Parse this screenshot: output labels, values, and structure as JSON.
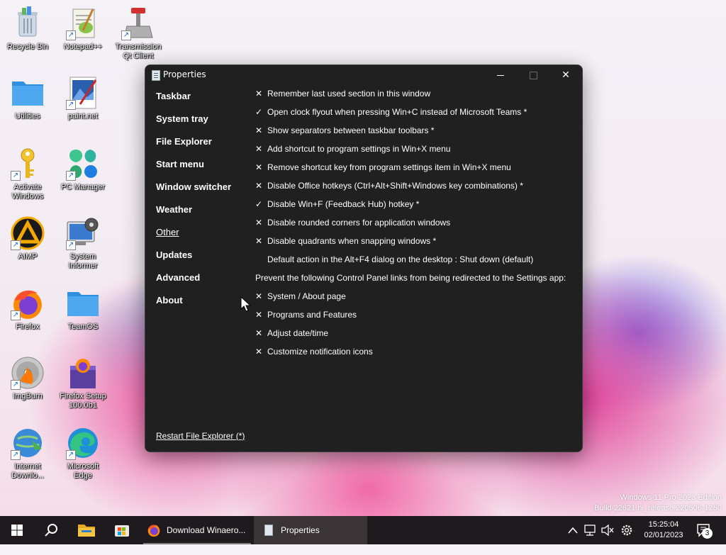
{
  "desktop": {
    "icons": [
      {
        "label": "Recycle Bin",
        "icon": "recycle-bin-icon"
      },
      {
        "label": "Notepad++",
        "icon": "notepad-plus-plus-icon"
      },
      {
        "label": "Transmission Qt Client",
        "icon": "transmission-icon"
      },
      {
        "label": "Utilities",
        "icon": "folder-icon"
      },
      {
        "label": "paint.net",
        "icon": "paint-net-icon"
      },
      {
        "label": "Activate Windows",
        "icon": "key-icon"
      },
      {
        "label": "PC Manager",
        "icon": "pc-manager-icon"
      },
      {
        "label": "AIMP",
        "icon": "aimp-icon"
      },
      {
        "label": "System Informer",
        "icon": "system-informer-icon"
      },
      {
        "label": "Firefox",
        "icon": "firefox-icon"
      },
      {
        "label": "TeamOS",
        "icon": "folder-icon"
      },
      {
        "label": "ImgBurn",
        "icon": "imgburn-icon"
      },
      {
        "label": "Firefox Setup 100.0b1",
        "icon": "firefox-setup-icon"
      },
      {
        "label": "Internet Downlo...",
        "icon": "idm-icon"
      },
      {
        "label": "Microsoft Edge",
        "icon": "edge-icon"
      }
    ],
    "watermark": {
      "line1": "Windows 11 Pro 2023 Edition",
      "line2": "Build 22621.ni_release.220506-1250"
    }
  },
  "window": {
    "title": "Properties",
    "nav": [
      {
        "label": "Taskbar",
        "active": false
      },
      {
        "label": "System tray",
        "active": false
      },
      {
        "label": "File Explorer",
        "active": false
      },
      {
        "label": "Start menu",
        "active": false
      },
      {
        "label": "Window switcher",
        "active": false
      },
      {
        "label": "Weather",
        "active": false
      },
      {
        "label": "Other",
        "active": true
      },
      {
        "label": "Updates",
        "active": false
      },
      {
        "label": "Advanced",
        "active": false
      },
      {
        "label": "About",
        "active": false
      }
    ],
    "options": [
      {
        "mark": "✕",
        "label": "Remember last used section in this window"
      },
      {
        "mark": "✓",
        "label": "Open clock flyout when pressing Win+C instead of Microsoft Teams *"
      },
      {
        "mark": "✕",
        "label": "Show separators between taskbar toolbars *"
      },
      {
        "mark": "✕",
        "label": "Add shortcut to program settings in Win+X menu"
      },
      {
        "mark": "✕",
        "label": "Remove shortcut key from program settings item in Win+X menu"
      },
      {
        "mark": "✕",
        "label": "Disable Office hotkeys (Ctrl+Alt+Shift+Windows key combinations) *"
      },
      {
        "mark": "✓",
        "label": "Disable Win+F (Feedback Hub) hotkey *"
      },
      {
        "mark": "✕",
        "label": "Disable rounded corners for application windows"
      },
      {
        "mark": "✕",
        "label": "Disable quadrants when snapping windows *"
      },
      {
        "mark": "",
        "label": "Default action in the Alt+F4 dialog on the desktop : Shut down (default)"
      }
    ],
    "section_header": "Prevent the following Control Panel links from being redirected to the Settings app:",
    "links": [
      {
        "mark": "✕",
        "label": "System / About page"
      },
      {
        "mark": "✕",
        "label": "Programs and Features"
      },
      {
        "mark": "✕",
        "label": "Adjust date/time"
      },
      {
        "mark": "✕",
        "label": "Customize notification icons"
      }
    ],
    "restart_label": "Restart File Explorer (*)"
  },
  "taskbar": {
    "apps": [
      {
        "label": "Download Winaero...",
        "icon": "firefox-icon",
        "active": false
      },
      {
        "label": "Properties",
        "icon": "properties-icon",
        "active": true
      }
    ],
    "clock": {
      "time": "15:25:04",
      "date": "02/01/2023"
    },
    "notification_count": "3"
  },
  "colors": {
    "window_bg": "#202020",
    "taskbar_bg": "#1e1a1d",
    "text": "#ffffff"
  }
}
